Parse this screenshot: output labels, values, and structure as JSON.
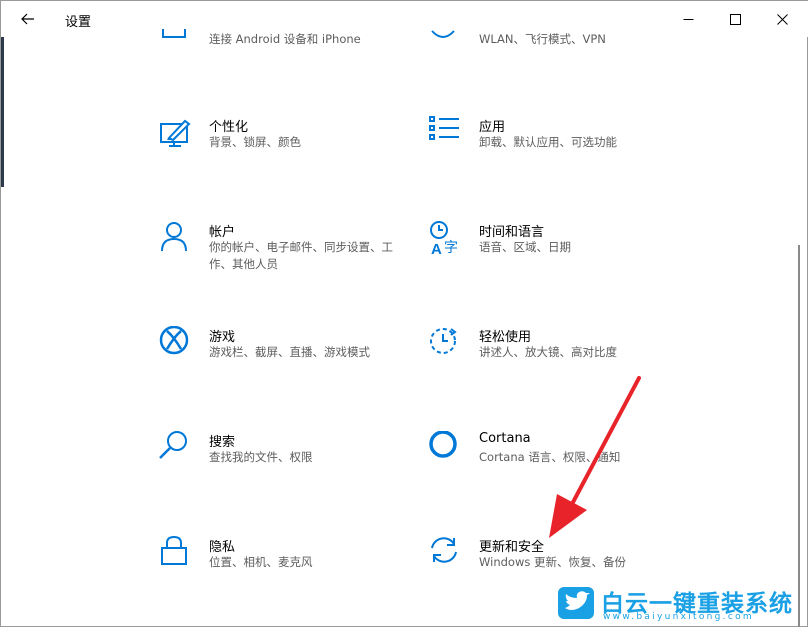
{
  "window": {
    "title": "设置"
  },
  "top_partial": {
    "left_desc": "连接 Android 设备和 iPhone",
    "right_desc": "WLAN、飞行模式、VPN"
  },
  "items": [
    {
      "label": "个性化",
      "desc": "背景、锁屏、颜色",
      "icon": "personalization-icon"
    },
    {
      "label": "应用",
      "desc": "卸载、默认应用、可选功能",
      "icon": "apps-icon"
    },
    {
      "label": "帐户",
      "desc": "你的帐户、电子邮件、同步设置、工作、其他人员",
      "icon": "account-icon"
    },
    {
      "label": "时间和语言",
      "desc": "语音、区域、日期",
      "icon": "time-language-icon"
    },
    {
      "label": "游戏",
      "desc": "游戏栏、截屏、直播、游戏模式",
      "icon": "xbox-icon"
    },
    {
      "label": "轻松使用",
      "desc": "讲述人、放大镜、高对比度",
      "icon": "ease-of-access-icon"
    },
    {
      "label": "搜索",
      "desc": "查找我的文件、权限",
      "icon": "search-icon"
    },
    {
      "label": "Cortana",
      "desc": "Cortana 语言、权限、通知",
      "icon": "cortana-icon"
    },
    {
      "label": "隐私",
      "desc": "位置、相机、麦克风",
      "icon": "lock-icon"
    },
    {
      "label": "更新和安全",
      "desc": "Windows 更新、恢复、备份",
      "icon": "update-icon"
    }
  ],
  "watermark": {
    "title": "白云一键重装系统",
    "url": "www.baiyunxitong.com"
  },
  "colors": {
    "accent": "#0078d7",
    "arrow": "#e8242a",
    "watermark": "#1aa0e4"
  }
}
